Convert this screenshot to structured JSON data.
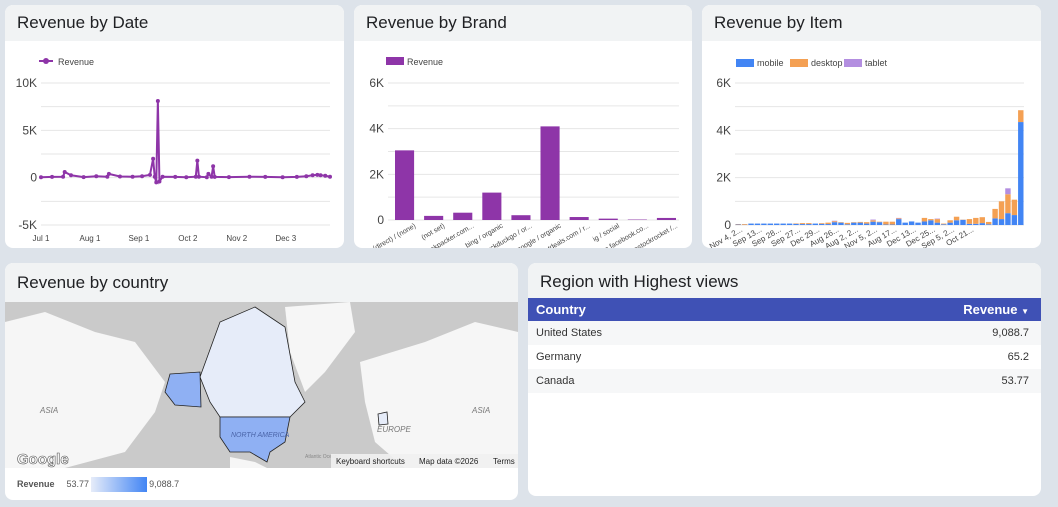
{
  "cards": {
    "date": "Revenue by Date",
    "brand": "Revenue by Brand",
    "item": "Revenue by Item",
    "country": "Revenue by country",
    "region": "Region with Highest views"
  },
  "chart_data": [
    {
      "type": "line",
      "title": "Revenue by Date",
      "legend": [
        "Revenue"
      ],
      "color": "#8e35a8",
      "ylim": [
        -5000,
        10000
      ],
      "yticks": [
        "10K",
        "5K",
        "0",
        "-5K"
      ],
      "xticks": [
        "Jul 1",
        "Aug 1",
        "Sep 1",
        "Oct 2",
        "Nov 2",
        "Dec 3"
      ],
      "x": [
        "Jul 1",
        "Jul 8",
        "Jul 15",
        "Jul 16",
        "Jul 20",
        "Jul 28",
        "Aug 5",
        "Aug 12",
        "Aug 13",
        "Aug 20",
        "Aug 28",
        "Sep 3",
        "Sep 8",
        "Sep 10",
        "Sep 11",
        "Sep 12",
        "Sep 13",
        "Sep 14",
        "Sep 16",
        "Sep 24",
        "Oct 1",
        "Oct 7",
        "Oct 8",
        "Oct 9",
        "Oct 14",
        "Oct 15",
        "Oct 17",
        "Oct 18",
        "Oct 19",
        "Oct 28",
        "Nov 10",
        "Nov 20",
        "Dec 1",
        "Dec 10",
        "Dec 16",
        "Dec 20",
        "Dec 23",
        "Dec 25",
        "Dec 28",
        "Dec 31"
      ],
      "values": [
        50,
        80,
        100,
        600,
        250,
        60,
        150,
        100,
        400,
        120,
        100,
        150,
        300,
        2000,
        100,
        -500,
        8100,
        -400,
        100,
        80,
        50,
        100,
        1800,
        100,
        50,
        400,
        100,
        1200,
        80,
        60,
        100,
        80,
        50,
        90,
        150,
        250,
        300,
        250,
        200,
        100
      ]
    },
    {
      "type": "bar",
      "title": "Revenue by Brand",
      "legend": [
        "Revenue"
      ],
      "color": "#8e35a8",
      "ylim": [
        0,
        6000
      ],
      "yticks": [
        "6K",
        "4K",
        "2K",
        "0"
      ],
      "categories": [
        "(direct) / (none)",
        "(not set)",
        "backpacker.com...",
        "bing / organic",
        "duckduckgo / or...",
        "google / organic",
        "hotdeals.com / r...",
        "ig / social",
        "m.facebook.co...",
        "restockrocket /..."
      ],
      "values": [
        3050,
        180,
        320,
        1200,
        210,
        4100,
        130,
        60,
        20,
        90
      ]
    },
    {
      "type": "bar",
      "stacked": true,
      "title": "Revenue by Item",
      "ylim": [
        0,
        6000
      ],
      "yticks": [
        "6K",
        "4K",
        "2K",
        "0"
      ],
      "categories": [
        "Nov 4, 2...",
        "",
        "",
        "Sep 13...",
        "",
        "",
        "Sep 28...",
        "",
        "",
        "Sep 27...",
        "",
        "",
        "Dec 29...",
        "",
        "",
        "Aug 26...",
        "",
        "",
        "Aug 2, 2...",
        "",
        "",
        "Nov 5, 2...",
        "",
        "",
        "Aug 17...",
        "",
        "",
        "Dec 13...",
        "",
        "",
        "Dec 25...",
        "",
        "",
        "Sep 5, 2...",
        "",
        "",
        "Oct 21...",
        "",
        "",
        ""
      ],
      "series": [
        {
          "name": "mobile",
          "color": "#4285f4",
          "values": [
            20,
            10,
            60,
            60,
            60,
            60,
            60,
            60,
            60,
            50,
            40,
            40,
            60,
            50,
            40,
            120,
            100,
            30,
            100,
            100,
            60,
            140,
            120,
            20,
            20,
            250,
            100,
            150,
            100,
            150,
            200,
            100,
            30,
            100,
            200,
            220,
            50,
            50,
            80,
            30,
            280,
            250,
            500,
            420,
            4350
          ]
        },
        {
          "name": "desktop",
          "color": "#f4a053",
          "values": [
            20,
            30,
            0,
            0,
            0,
            0,
            0,
            0,
            0,
            20,
            40,
            40,
            0,
            30,
            60,
            40,
            20,
            60,
            20,
            30,
            60,
            60,
            20,
            120,
            120,
            30,
            0,
            0,
            0,
            150,
            50,
            150,
            30,
            100,
            150,
            10,
            200,
            250,
            250,
            100,
            400,
            750,
            800,
            650,
            500,
            1450
          ]
        },
        {
          "name": "tablet",
          "color": "#b38ee0",
          "values": [
            0,
            0,
            0,
            0,
            0,
            0,
            0,
            0,
            0,
            0,
            0,
            0,
            0,
            0,
            0,
            20,
            0,
            0,
            0,
            0,
            0,
            30,
            0,
            0,
            0,
            20,
            0,
            0,
            0,
            0,
            0,
            20,
            0,
            0,
            0,
            0,
            0,
            0,
            0,
            0,
            0,
            0,
            250,
            0,
            0,
            0
          ]
        }
      ]
    }
  ],
  "map": {
    "labels": {
      "asia_left": "ASIA",
      "asia_right": "ASIA",
      "na": "NORTH AMERICA",
      "europe": "EUROPE",
      "ocean": "Atlantic Ocean"
    },
    "google": "Google",
    "shortcuts": "Keyboard shortcuts",
    "mapdata": "Map data ©2026",
    "terms": "Terms",
    "legend": {
      "label": "Revenue",
      "min": "53.77",
      "max": "9,088.7",
      "color_low": "#e6ecf9",
      "color_high": "#4285f4"
    }
  },
  "table": {
    "headers": [
      "Country",
      "Revenue"
    ],
    "sort_icon": "sort-desc-icon",
    "rows": [
      {
        "country": "United States",
        "revenue": "9,088.7"
      },
      {
        "country": "Germany",
        "revenue": "65.2"
      },
      {
        "country": "Canada",
        "revenue": "53.77"
      }
    ]
  }
}
